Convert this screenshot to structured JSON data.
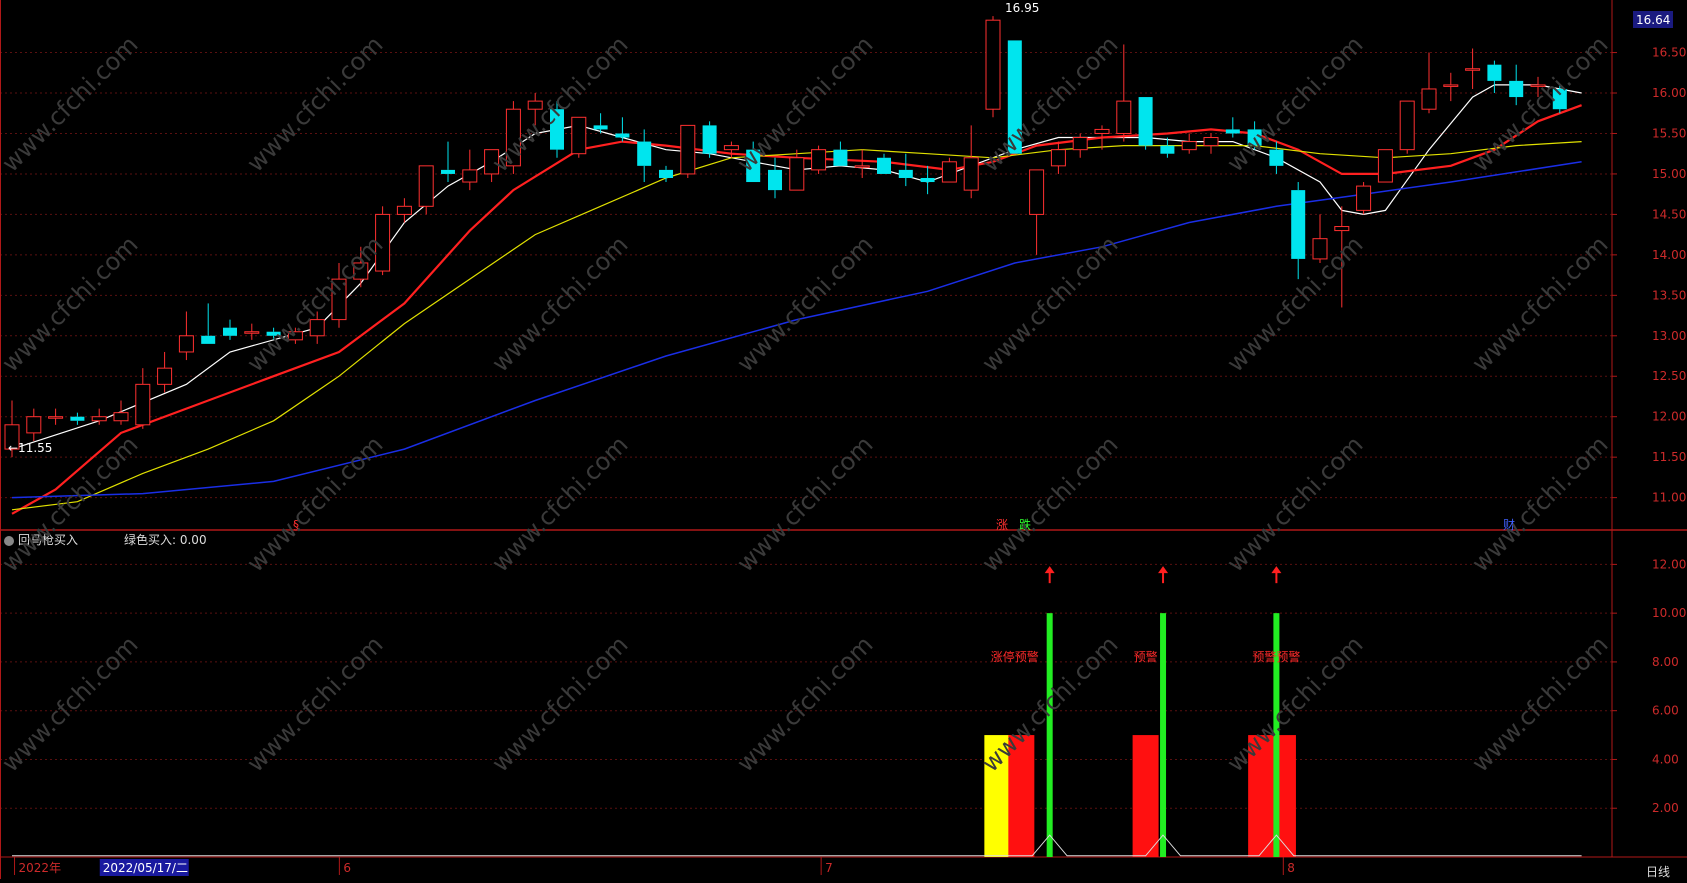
{
  "chart_data": [
    {
      "type": "candlestick",
      "panel": "main",
      "ylim": [
        10.6,
        17.1
      ],
      "y_ticks": [
        "11.00",
        "11.50",
        "12.00",
        "12.50",
        "13.00",
        "13.50",
        "14.00",
        "14.50",
        "15.00",
        "15.50",
        "16.00",
        "16.50"
      ],
      "current_price": "16.64",
      "annotations": {
        "low_label": "←11.55",
        "high_label": "16.95",
        "marker_s": "§",
        "marker_zhang": "涨",
        "marker_die": "跌",
        "marker_cai": "财"
      },
      "candles": [
        {
          "o": 11.6,
          "h": 12.2,
          "l": 11.5,
          "c": 11.9
        },
        {
          "o": 11.8,
          "h": 12.1,
          "l": 11.7,
          "c": 12.0
        },
        {
          "o": 12.0,
          "h": 12.1,
          "l": 11.9,
          "c": 12.0
        },
        {
          "o": 12.0,
          "h": 12.05,
          "l": 11.9,
          "c": 11.95
        },
        {
          "o": 11.95,
          "h": 12.1,
          "l": 11.9,
          "c": 12.0
        },
        {
          "o": 11.95,
          "h": 12.2,
          "l": 11.9,
          "c": 12.05
        },
        {
          "o": 11.9,
          "h": 12.6,
          "l": 11.85,
          "c": 12.4
        },
        {
          "o": 12.4,
          "h": 12.8,
          "l": 12.3,
          "c": 12.6
        },
        {
          "o": 12.8,
          "h": 13.3,
          "l": 12.7,
          "c": 13.0
        },
        {
          "o": 13.0,
          "h": 13.4,
          "l": 12.9,
          "c": 12.9
        },
        {
          "o": 13.1,
          "h": 13.2,
          "l": 12.95,
          "c": 13.0
        },
        {
          "o": 13.05,
          "h": 13.15,
          "l": 12.95,
          "c": 13.05
        },
        {
          "o": 13.05,
          "h": 13.1,
          "l": 12.95,
          "c": 13.0
        },
        {
          "o": 12.95,
          "h": 13.1,
          "l": 12.9,
          "c": 13.05
        },
        {
          "o": 13.0,
          "h": 13.3,
          "l": 12.9,
          "c": 13.2
        },
        {
          "o": 13.2,
          "h": 13.9,
          "l": 13.1,
          "c": 13.7
        },
        {
          "o": 13.7,
          "h": 14.1,
          "l": 13.6,
          "c": 13.9
        },
        {
          "o": 13.8,
          "h": 14.6,
          "l": 13.75,
          "c": 14.5
        },
        {
          "o": 14.5,
          "h": 14.7,
          "l": 14.4,
          "c": 14.6
        },
        {
          "o": 14.6,
          "h": 15.1,
          "l": 14.5,
          "c": 15.1
        },
        {
          "o": 15.05,
          "h": 15.4,
          "l": 14.9,
          "c": 15.0
        },
        {
          "o": 14.9,
          "h": 15.3,
          "l": 14.8,
          "c": 15.05
        },
        {
          "o": 15.0,
          "h": 15.3,
          "l": 14.9,
          "c": 15.3
        },
        {
          "o": 15.1,
          "h": 15.9,
          "l": 15.0,
          "c": 15.8
        },
        {
          "o": 15.8,
          "h": 16.0,
          "l": 15.6,
          "c": 15.9
        },
        {
          "o": 15.8,
          "h": 15.9,
          "l": 15.2,
          "c": 15.3
        },
        {
          "o": 15.25,
          "h": 15.7,
          "l": 15.2,
          "c": 15.7
        },
        {
          "o": 15.6,
          "h": 15.75,
          "l": 15.5,
          "c": 15.55
        },
        {
          "o": 15.5,
          "h": 15.7,
          "l": 15.4,
          "c": 15.45
        },
        {
          "o": 15.4,
          "h": 15.55,
          "l": 14.9,
          "c": 15.1
        },
        {
          "o": 15.05,
          "h": 15.1,
          "l": 14.9,
          "c": 14.95
        },
        {
          "o": 15.0,
          "h": 15.6,
          "l": 14.95,
          "c": 15.6
        },
        {
          "o": 15.6,
          "h": 15.65,
          "l": 15.2,
          "c": 15.25
        },
        {
          "o": 15.3,
          "h": 15.4,
          "l": 15.2,
          "c": 15.35
        },
        {
          "o": 15.3,
          "h": 15.4,
          "l": 14.9,
          "c": 14.9
        },
        {
          "o": 15.05,
          "h": 15.2,
          "l": 14.7,
          "c": 14.8
        },
        {
          "o": 14.8,
          "h": 15.3,
          "l": 14.8,
          "c": 15.2
        },
        {
          "o": 15.05,
          "h": 15.35,
          "l": 15.0,
          "c": 15.3
        },
        {
          "o": 15.3,
          "h": 15.4,
          "l": 15.1,
          "c": 15.1
        },
        {
          "o": 15.1,
          "h": 15.3,
          "l": 14.95,
          "c": 15.1
        },
        {
          "o": 15.2,
          "h": 15.25,
          "l": 15.0,
          "c": 15.0
        },
        {
          "o": 15.05,
          "h": 15.25,
          "l": 14.85,
          "c": 14.95
        },
        {
          "o": 14.95,
          "h": 15.1,
          "l": 14.75,
          "c": 14.9
        },
        {
          "o": 14.9,
          "h": 15.2,
          "l": 14.9,
          "c": 15.15
        },
        {
          "o": 14.8,
          "h": 15.6,
          "l": 14.7,
          "c": 15.2
        },
        {
          "o": 15.8,
          "h": 16.95,
          "l": 15.7,
          "c": 16.9
        },
        {
          "o": 16.65,
          "h": 16.65,
          "l": 15.25,
          "c": 15.25
        },
        {
          "o": 14.5,
          "h": 15.0,
          "l": 14.0,
          "c": 15.05
        },
        {
          "o": 15.1,
          "h": 15.4,
          "l": 15.0,
          "c": 15.3
        },
        {
          "o": 15.3,
          "h": 15.5,
          "l": 15.2,
          "c": 15.45
        },
        {
          "o": 15.5,
          "h": 15.6,
          "l": 15.3,
          "c": 15.55
        },
        {
          "o": 15.5,
          "h": 16.6,
          "l": 15.4,
          "c": 15.9
        },
        {
          "o": 15.95,
          "h": 15.95,
          "l": 15.3,
          "c": 15.35
        },
        {
          "o": 15.35,
          "h": 15.45,
          "l": 15.2,
          "c": 15.25
        },
        {
          "o": 15.3,
          "h": 15.5,
          "l": 15.25,
          "c": 15.4
        },
        {
          "o": 15.35,
          "h": 15.5,
          "l": 15.25,
          "c": 15.45
        },
        {
          "o": 15.55,
          "h": 15.7,
          "l": 15.45,
          "c": 15.5
        },
        {
          "o": 15.55,
          "h": 15.65,
          "l": 15.3,
          "c": 15.35
        },
        {
          "o": 15.3,
          "h": 15.4,
          "l": 15.0,
          "c": 15.1
        },
        {
          "o": 14.8,
          "h": 14.9,
          "l": 13.7,
          "c": 13.95
        },
        {
          "o": 13.95,
          "h": 14.5,
          "l": 13.9,
          "c": 14.2
        },
        {
          "o": 14.3,
          "h": 14.6,
          "l": 13.35,
          "c": 14.35
        },
        {
          "o": 14.55,
          "h": 14.9,
          "l": 14.5,
          "c": 14.85
        },
        {
          "o": 14.9,
          "h": 15.3,
          "l": 14.9,
          "c": 15.3
        },
        {
          "o": 15.3,
          "h": 15.9,
          "l": 15.25,
          "c": 15.9
        },
        {
          "o": 15.8,
          "h": 16.5,
          "l": 15.75,
          "c": 16.05
        },
        {
          "o": 16.1,
          "h": 16.25,
          "l": 15.9,
          "c": 16.1
        },
        {
          "o": 16.3,
          "h": 16.55,
          "l": 16.05,
          "c": 16.3
        },
        {
          "o": 16.35,
          "h": 16.4,
          "l": 16.0,
          "c": 16.15
        },
        {
          "o": 16.15,
          "h": 16.35,
          "l": 15.85,
          "c": 15.95
        },
        {
          "o": 16.1,
          "h": 16.2,
          "l": 15.95,
          "c": 16.1
        },
        {
          "o": 16.05,
          "h": 16.1,
          "l": 15.75,
          "c": 15.8
        }
      ],
      "series": [
        {
          "name": "",
          "color": "#ffffff",
          "width": 1.2,
          "points": [
            [
              0,
              11.6
            ],
            [
              4,
              11.95
            ],
            [
              8,
              12.4
            ],
            [
              10,
              12.8
            ],
            [
              14,
              13.1
            ],
            [
              16,
              13.65
            ],
            [
              18,
              14.4
            ],
            [
              20,
              14.85
            ],
            [
              22,
              15.15
            ],
            [
              24,
              15.5
            ],
            [
              26,
              15.6
            ],
            [
              28,
              15.45
            ],
            [
              30,
              15.3
            ],
            [
              32,
              15.25
            ],
            [
              34,
              15.15
            ],
            [
              36,
              15.05
            ],
            [
              38,
              15.1
            ],
            [
              40,
              15.05
            ],
            [
              42,
              14.9
            ],
            [
              44,
              15.1
            ],
            [
              46,
              15.3
            ],
            [
              48,
              15.45
            ],
            [
              50,
              15.45
            ],
            [
              52,
              15.45
            ],
            [
              54,
              15.4
            ],
            [
              56,
              15.4
            ],
            [
              58,
              15.2
            ],
            [
              60,
              14.9
            ],
            [
              61,
              14.55
            ],
            [
              62,
              14.5
            ],
            [
              63,
              14.55
            ],
            [
              65,
              15.3
            ],
            [
              67,
              15.95
            ],
            [
              68,
              16.1
            ],
            [
              70,
              16.1
            ],
            [
              72,
              16.0
            ]
          ]
        },
        {
          "name": "",
          "color": "#ff2020",
          "width": 2.2,
          "points": [
            [
              0,
              10.8
            ],
            [
              2,
              11.1
            ],
            [
              5,
              11.8
            ],
            [
              8,
              12.1
            ],
            [
              12,
              12.5
            ],
            [
              15,
              12.8
            ],
            [
              18,
              13.4
            ],
            [
              21,
              14.3
            ],
            [
              23,
              14.8
            ],
            [
              26,
              15.3
            ],
            [
              28,
              15.4
            ],
            [
              30,
              15.35
            ],
            [
              33,
              15.25
            ],
            [
              36,
              15.2
            ],
            [
              40,
              15.15
            ],
            [
              43,
              15.05
            ],
            [
              45,
              15.15
            ],
            [
              47,
              15.35
            ],
            [
              50,
              15.45
            ],
            [
              53,
              15.5
            ],
            [
              55,
              15.55
            ],
            [
              57,
              15.5
            ],
            [
              59,
              15.3
            ],
            [
              61,
              15.0
            ],
            [
              63,
              15.0
            ],
            [
              66,
              15.1
            ],
            [
              68,
              15.3
            ],
            [
              70,
              15.65
            ],
            [
              72,
              15.85
            ]
          ]
        },
        {
          "name": "",
          "color": "#e0e000",
          "width": 1.2,
          "points": [
            [
              0,
              10.85
            ],
            [
              3,
              10.95
            ],
            [
              6,
              11.3
            ],
            [
              9,
              11.6
            ],
            [
              12,
              11.95
            ],
            [
              15,
              12.5
            ],
            [
              18,
              13.15
            ],
            [
              21,
              13.7
            ],
            [
              24,
              14.25
            ],
            [
              27,
              14.6
            ],
            [
              30,
              14.95
            ],
            [
              33,
              15.2
            ],
            [
              36,
              15.25
            ],
            [
              39,
              15.3
            ],
            [
              42,
              15.25
            ],
            [
              45,
              15.2
            ],
            [
              48,
              15.3
            ],
            [
              51,
              15.35
            ],
            [
              54,
              15.35
            ],
            [
              57,
              15.35
            ],
            [
              60,
              15.25
            ],
            [
              63,
              15.2
            ],
            [
              66,
              15.25
            ],
            [
              69,
              15.35
            ],
            [
              72,
              15.4
            ]
          ]
        },
        {
          "name": "",
          "color": "#1a2ee6",
          "width": 1.5,
          "points": [
            [
              0,
              11.0
            ],
            [
              6,
              11.05
            ],
            [
              12,
              11.2
            ],
            [
              18,
              11.6
            ],
            [
              24,
              12.2
            ],
            [
              30,
              12.75
            ],
            [
              36,
              13.2
            ],
            [
              42,
              13.55
            ],
            [
              46,
              13.9
            ],
            [
              50,
              14.1
            ],
            [
              54,
              14.4
            ],
            [
              58,
              14.6
            ],
            [
              62,
              14.75
            ],
            [
              66,
              14.9
            ],
            [
              72,
              15.15
            ]
          ]
        }
      ]
    },
    {
      "type": "bar",
      "panel": "indicator",
      "title": "回马枪买入",
      "legend": "绿色买入: 0.00",
      "ylim": [
        0,
        13
      ],
      "y_ticks": [
        "2.00",
        "4.00",
        "6.00",
        "8.00",
        "10.00",
        "12.00"
      ],
      "bars": [
        {
          "i": 45.2,
          "value": 5,
          "color": "#ffff00"
        },
        {
          "i": 46.3,
          "value": 5,
          "color": "#ff1010"
        },
        {
          "i": 52.0,
          "value": 5,
          "color": "#ff1010"
        },
        {
          "i": 57.3,
          "value": 5,
          "color": "#ff1010"
        },
        {
          "i": 58.3,
          "value": 5,
          "color": "#ff1010"
        }
      ],
      "green_lines": [
        {
          "i": 47.6,
          "value": 10
        },
        {
          "i": 52.8,
          "value": 10
        },
        {
          "i": 58.0,
          "value": 10
        }
      ],
      "white_line": [
        [
          0,
          0.05
        ],
        [
          46.8,
          0.05
        ],
        [
          47.6,
          0.9
        ],
        [
          48.4,
          0.05
        ],
        [
          52.0,
          0.05
        ],
        [
          52.8,
          0.9
        ],
        [
          53.6,
          0.05
        ],
        [
          57.2,
          0.05
        ],
        [
          58.0,
          0.9
        ],
        [
          58.8,
          0.05
        ],
        [
          72,
          0.05
        ]
      ],
      "labels": [
        {
          "i": 46.0,
          "text": "涨停预警"
        },
        {
          "i": 52.0,
          "text": "预警"
        },
        {
          "i": 58.0,
          "text": "预警预警"
        }
      ]
    }
  ],
  "x_axis": {
    "labels": [
      {
        "i": 0.3,
        "text": "2022年"
      },
      {
        "i": 4.3,
        "text": "2022/05/17/二"
      },
      {
        "i": 15.2,
        "text": "6"
      },
      {
        "i": 37.3,
        "text": "7"
      },
      {
        "i": 58.5,
        "text": "8"
      }
    ],
    "period": "日线"
  }
}
